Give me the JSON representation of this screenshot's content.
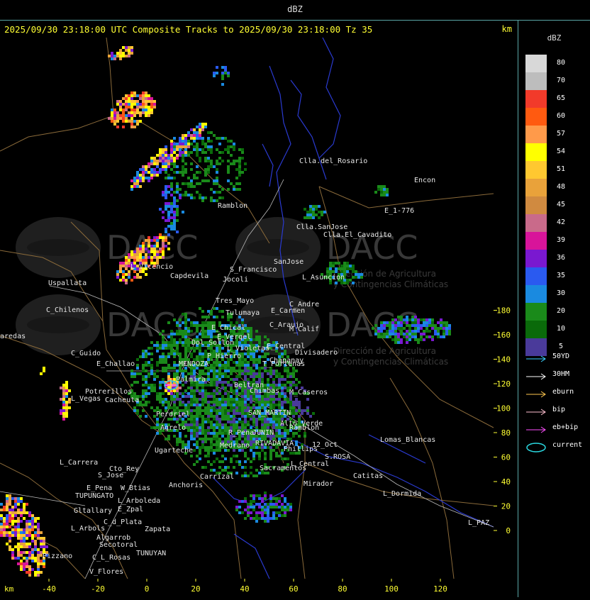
{
  "window_title": "dBZ",
  "header": {
    "title": "2025/09/30 23:18:00 UTC Composite Tracks to 2025/09/30 23:18:00 Tz 35",
    "unit": "km"
  },
  "axes": {
    "y_ticks": [
      "180",
      "160",
      "140",
      "120",
      "100",
      "80",
      "60",
      "40",
      "20",
      "0"
    ],
    "x_ticks": [
      "-40",
      "-20",
      "0",
      "20",
      "40",
      "60",
      "80",
      "100",
      "120"
    ],
    "x_unit": "km"
  },
  "legend": {
    "title": "dBZ",
    "scale": [
      {
        "label": "80",
        "color": "#d8d8d8"
      },
      {
        "label": "70",
        "color": "#bdbdbd"
      },
      {
        "label": "65",
        "color": "#f23a2a"
      },
      {
        "label": "60",
        "color": "#ff5a10"
      },
      {
        "label": "57",
        "color": "#ff9a4a"
      },
      {
        "label": "54",
        "color": "#ffff00"
      },
      {
        "label": "51",
        "color": "#ffc830"
      },
      {
        "label": "48",
        "color": "#e9a23a"
      },
      {
        "label": "45",
        "color": "#d08a40"
      },
      {
        "label": "42",
        "color": "#c96a8a"
      },
      {
        "label": "39",
        "color": "#d8149a"
      },
      {
        "label": "36",
        "color": "#7a18d0"
      },
      {
        "label": "35",
        "color": "#2a5af0"
      },
      {
        "label": "30",
        "color": "#1a8ae0"
      },
      {
        "label": "20",
        "color": "#1a8a1a"
      },
      {
        "label": "10",
        "color": "#0a6a0a"
      },
      {
        "label": "5",
        "color": "#4a3a9a"
      }
    ],
    "tracks": [
      {
        "label": "50YD",
        "color": "#3ad0ff"
      },
      {
        "label": "30HM",
        "color": "#ffffff"
      },
      {
        "label": "eburn",
        "color": "#ffc850"
      },
      {
        "label": "bip",
        "color": "#ffc0d0"
      },
      {
        "label": "eb+bip",
        "color": "#ff50ff"
      },
      {
        "label": "current",
        "color": "#2ad8e0"
      }
    ]
  },
  "watermark": {
    "brand": "DACC",
    "line1": "Dirección de Agricultura",
    "line2": "y Contingencias Climáticas"
  },
  "places": [
    {
      "label": "Clla.del_Rosario"
    },
    {
      "label": "Encon"
    },
    {
      "label": "E_1-776"
    },
    {
      "label": "Ramblon"
    },
    {
      "label": "Clla.SanJose"
    },
    {
      "label": "Clla.El_Cavadito"
    },
    {
      "label": "Uspallata"
    },
    {
      "label": "Capdevila"
    },
    {
      "label": "S_Francisco"
    },
    {
      "label": "SanJose"
    },
    {
      "label": "L_Asuncion"
    },
    {
      "label": "Jocoli"
    },
    {
      "label": "C_Chilenos"
    },
    {
      "label": "Tres_Mayo"
    },
    {
      "label": "Tulumaya"
    },
    {
      "label": "E_Carmen"
    },
    {
      "label": "C_Andre"
    },
    {
      "label": "E_Chical"
    },
    {
      "label": "E_Vergel"
    },
    {
      "label": "C_Araujo"
    },
    {
      "label": "M_Calif"
    },
    {
      "label": "Dol_Sollon"
    },
    {
      "label": "L_Violetas"
    },
    {
      "label": "E_Central"
    },
    {
      "label": "Divisadero"
    },
    {
      "label": "C_Guido"
    },
    {
      "label": "P_Hierro"
    },
    {
      "label": "E_Challao"
    },
    {
      "label": "T_Portenas"
    },
    {
      "label": "Chapanay"
    },
    {
      "label": "Potrerillos"
    },
    {
      "label": "Cacheuta"
    },
    {
      "label": "L_Vegas"
    },
    {
      "label": "Beltran"
    },
    {
      "label": "Palmira"
    },
    {
      "label": "Chimbas"
    },
    {
      "label": "M_Caseros"
    },
    {
      "label": "Perdriel"
    },
    {
      "label": "Agrelo"
    },
    {
      "label": "SAN_MARTIN"
    },
    {
      "label": "Alto_Verde"
    },
    {
      "label": "Ramblon"
    },
    {
      "label": "R_Pena"
    },
    {
      "label": "JUNIN"
    },
    {
      "label": "Ugarteche"
    },
    {
      "label": "Medrano"
    },
    {
      "label": "RIVADAVIA"
    },
    {
      "label": "Phillips"
    },
    {
      "label": "12_Oct"
    },
    {
      "label": "Lomas_Blancas"
    },
    {
      "label": "S.ROSA"
    },
    {
      "label": "L_Carrera"
    },
    {
      "label": "Cto_Rey"
    },
    {
      "label": "S_Jose"
    },
    {
      "label": "Carrizal"
    },
    {
      "label": "Sacramentos"
    },
    {
      "label": "L_Central"
    },
    {
      "label": "Catitas"
    },
    {
      "label": "E_Pena"
    },
    {
      "label": "W_Btias"
    },
    {
      "label": "Anchoris"
    },
    {
      "label": "TUPUNGATO"
    },
    {
      "label": "Mirador"
    },
    {
      "label": "L_Dormida"
    },
    {
      "label": "L_Arboleda"
    },
    {
      "label": "Gltallary"
    },
    {
      "label": "E_Zpal"
    },
    {
      "label": "L_Arbols"
    },
    {
      "label": "C_d_Plata"
    },
    {
      "label": "Zapata"
    },
    {
      "label": "L_PAZ"
    },
    {
      "label": "Algarrob"
    },
    {
      "label": "Secotoral"
    },
    {
      "label": "TUNUYAN"
    },
    {
      "label": "Pizzano"
    },
    {
      "label": "C_L_Rosas"
    },
    {
      "label": "V_Flores"
    },
    {
      "label": "aredas"
    },
    {
      "label": "L_Vicencio"
    },
    {
      "label": "MENDOZA"
    }
  ]
}
